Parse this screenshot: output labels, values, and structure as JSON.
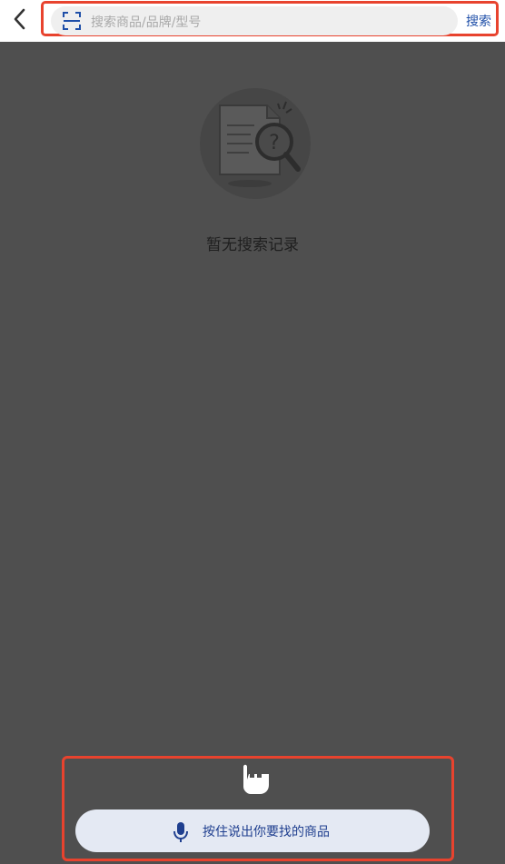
{
  "header": {
    "back_icon": "chevron-left-icon",
    "scan_icon": "scan-icon",
    "search_placeholder": "搜索商品/品牌/型号",
    "search_button": "搜索"
  },
  "empty_state": {
    "icon": "document-search-icon",
    "message": "暂无搜索记录"
  },
  "voice": {
    "hand_icon": "pointing-hand-icon",
    "mic_icon": "microphone-icon",
    "label": "按住说出你要找的商品"
  },
  "colors": {
    "accent": "#1f4fa8",
    "highlight_border": "#e8432e",
    "overlay_bg": "#4f4f4f"
  }
}
